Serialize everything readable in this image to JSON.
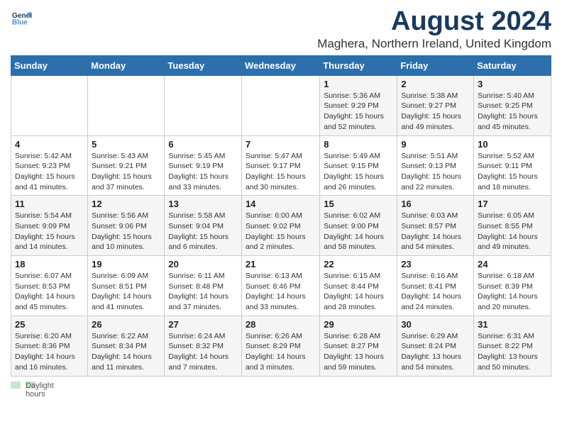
{
  "header": {
    "logo_line1": "General",
    "logo_line2": "Blue",
    "main_title": "August 2024",
    "sub_title": "Maghera, Northern Ireland, United Kingdom"
  },
  "days_of_week": [
    "Sunday",
    "Monday",
    "Tuesday",
    "Wednesday",
    "Thursday",
    "Friday",
    "Saturday"
  ],
  "weeks": [
    [
      {
        "day": "",
        "info": ""
      },
      {
        "day": "",
        "info": ""
      },
      {
        "day": "",
        "info": ""
      },
      {
        "day": "",
        "info": ""
      },
      {
        "day": "1",
        "info": "Sunrise: 5:36 AM\nSunset: 9:29 PM\nDaylight: 15 hours\nand 52 minutes."
      },
      {
        "day": "2",
        "info": "Sunrise: 5:38 AM\nSunset: 9:27 PM\nDaylight: 15 hours\nand 49 minutes."
      },
      {
        "day": "3",
        "info": "Sunrise: 5:40 AM\nSunset: 9:25 PM\nDaylight: 15 hours\nand 45 minutes."
      }
    ],
    [
      {
        "day": "4",
        "info": "Sunrise: 5:42 AM\nSunset: 9:23 PM\nDaylight: 15 hours\nand 41 minutes."
      },
      {
        "day": "5",
        "info": "Sunrise: 5:43 AM\nSunset: 9:21 PM\nDaylight: 15 hours\nand 37 minutes."
      },
      {
        "day": "6",
        "info": "Sunrise: 5:45 AM\nSunset: 9:19 PM\nDaylight: 15 hours\nand 33 minutes."
      },
      {
        "day": "7",
        "info": "Sunrise: 5:47 AM\nSunset: 9:17 PM\nDaylight: 15 hours\nand 30 minutes."
      },
      {
        "day": "8",
        "info": "Sunrise: 5:49 AM\nSunset: 9:15 PM\nDaylight: 15 hours\nand 26 minutes."
      },
      {
        "day": "9",
        "info": "Sunrise: 5:51 AM\nSunset: 9:13 PM\nDaylight: 15 hours\nand 22 minutes."
      },
      {
        "day": "10",
        "info": "Sunrise: 5:52 AM\nSunset: 9:11 PM\nDaylight: 15 hours\nand 18 minutes."
      }
    ],
    [
      {
        "day": "11",
        "info": "Sunrise: 5:54 AM\nSunset: 9:09 PM\nDaylight: 15 hours\nand 14 minutes."
      },
      {
        "day": "12",
        "info": "Sunrise: 5:56 AM\nSunset: 9:06 PM\nDaylight: 15 hours\nand 10 minutes."
      },
      {
        "day": "13",
        "info": "Sunrise: 5:58 AM\nSunset: 9:04 PM\nDaylight: 15 hours\nand 6 minutes."
      },
      {
        "day": "14",
        "info": "Sunrise: 6:00 AM\nSunset: 9:02 PM\nDaylight: 15 hours\nand 2 minutes."
      },
      {
        "day": "15",
        "info": "Sunrise: 6:02 AM\nSunset: 9:00 PM\nDaylight: 14 hours\nand 58 minutes."
      },
      {
        "day": "16",
        "info": "Sunrise: 6:03 AM\nSunset: 8:57 PM\nDaylight: 14 hours\nand 54 minutes."
      },
      {
        "day": "17",
        "info": "Sunrise: 6:05 AM\nSunset: 8:55 PM\nDaylight: 14 hours\nand 49 minutes."
      }
    ],
    [
      {
        "day": "18",
        "info": "Sunrise: 6:07 AM\nSunset: 8:53 PM\nDaylight: 14 hours\nand 45 minutes."
      },
      {
        "day": "19",
        "info": "Sunrise: 6:09 AM\nSunset: 8:51 PM\nDaylight: 14 hours\nand 41 minutes."
      },
      {
        "day": "20",
        "info": "Sunrise: 6:11 AM\nSunset: 8:48 PM\nDaylight: 14 hours\nand 37 minutes."
      },
      {
        "day": "21",
        "info": "Sunrise: 6:13 AM\nSunset: 8:46 PM\nDaylight: 14 hours\nand 33 minutes."
      },
      {
        "day": "22",
        "info": "Sunrise: 6:15 AM\nSunset: 8:44 PM\nDaylight: 14 hours\nand 28 minutes."
      },
      {
        "day": "23",
        "info": "Sunrise: 6:16 AM\nSunset: 8:41 PM\nDaylight: 14 hours\nand 24 minutes."
      },
      {
        "day": "24",
        "info": "Sunrise: 6:18 AM\nSunset: 8:39 PM\nDaylight: 14 hours\nand 20 minutes."
      }
    ],
    [
      {
        "day": "25",
        "info": "Sunrise: 6:20 AM\nSunset: 8:36 PM\nDaylight: 14 hours\nand 16 minutes."
      },
      {
        "day": "26",
        "info": "Sunrise: 6:22 AM\nSunset: 8:34 PM\nDaylight: 14 hours\nand 11 minutes."
      },
      {
        "day": "27",
        "info": "Sunrise: 6:24 AM\nSunset: 8:32 PM\nDaylight: 14 hours\nand 7 minutes."
      },
      {
        "day": "28",
        "info": "Sunrise: 6:26 AM\nSunset: 8:29 PM\nDaylight: 14 hours\nand 3 minutes."
      },
      {
        "day": "29",
        "info": "Sunrise: 6:28 AM\nSunset: 8:27 PM\nDaylight: 13 hours\nand 59 minutes."
      },
      {
        "day": "30",
        "info": "Sunrise: 6:29 AM\nSunset: 8:24 PM\nDaylight: 13 hours\nand 54 minutes."
      },
      {
        "day": "31",
        "info": "Sunrise: 6:31 AM\nSunset: 8:22 PM\nDaylight: 13 hours\nand 50 minutes."
      }
    ]
  ],
  "footer": {
    "daylight_label": "Daylight hours"
  }
}
